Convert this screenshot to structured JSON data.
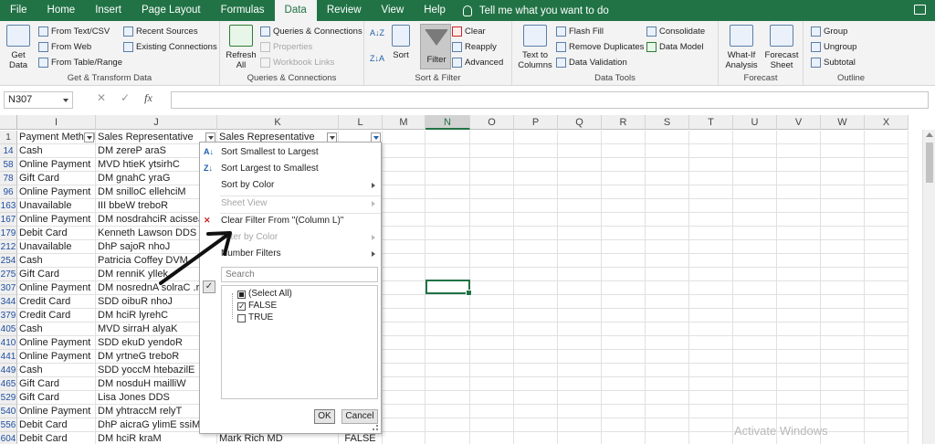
{
  "menu": {
    "tabs": [
      "File",
      "Home",
      "Insert",
      "Page Layout",
      "Formulas",
      "Data",
      "Review",
      "View",
      "Help"
    ],
    "active_tab": "Data",
    "tell_me": "Tell me what you want to do"
  },
  "ribbon": {
    "get_transform": {
      "get_data": "Get Data",
      "from_text_csv": "From Text/CSV",
      "from_web": "From Web",
      "from_table_range": "From Table/Range",
      "recent_sources": "Recent Sources",
      "existing_connections": "Existing Connections",
      "label": "Get & Transform Data"
    },
    "queries": {
      "refresh_all": "Refresh All",
      "queries_connections": "Queries & Connections",
      "properties": "Properties",
      "workbook_links": "Workbook Links",
      "label": "Queries & Connections"
    },
    "sort_filter": {
      "sort": "Sort",
      "filter": "Filter",
      "clear": "Clear",
      "reapply": "Reapply",
      "advanced": "Advanced",
      "label": "Sort & Filter"
    },
    "data_tools": {
      "text_to_columns": "Text to Columns",
      "flash_fill": "Flash Fill",
      "remove_duplicates": "Remove Duplicates",
      "data_validation": "Data Validation",
      "consolidate": "Consolidate",
      "data_model": "Data Model",
      "label": "Data Tools"
    },
    "forecast": {
      "what_if": "What-If Analysis",
      "forecast_sheet": "Forecast Sheet",
      "label": "Forecast"
    },
    "outline": {
      "group": "Group",
      "ungroup": "Ungroup",
      "subtotal": "Subtotal",
      "label": "Outline"
    }
  },
  "formula_bar": {
    "name_box": "N307",
    "fx": "fx",
    "cancel": "✕",
    "enter": "✓",
    "value": ""
  },
  "grid": {
    "column_headers": [
      "I",
      "J",
      "K",
      "L",
      "M",
      "N",
      "O",
      "P",
      "Q",
      "R",
      "S",
      "T",
      "U",
      "V",
      "W",
      "X"
    ],
    "selected_column": "N",
    "header_row": {
      "row_num": "1",
      "i": "Payment Method",
      "j": "Sales Representative",
      "k": "Sales Representative",
      "l": ""
    },
    "rows": [
      {
        "num": "14",
        "i": "Cash",
        "j": "DM zereP araS",
        "k": "",
        "l": ""
      },
      {
        "num": "58",
        "i": "Online Payment",
        "j": "MVD htieK ytsirhC",
        "k": "",
        "l": ""
      },
      {
        "num": "78",
        "i": "Gift Card",
        "j": "DM gnahC yraG",
        "k": "",
        "l": ""
      },
      {
        "num": "96",
        "i": "Online Payment",
        "j": "DM snilloC ellehciM",
        "k": "",
        "l": ""
      },
      {
        "num": "163",
        "i": "Unavailable",
        "j": "III bbeW treboR",
        "k": "",
        "l": ""
      },
      {
        "num": "167",
        "i": "Online Payment",
        "j": "DM nosdrahciR acisseJ",
        "k": "",
        "l": ""
      },
      {
        "num": "179",
        "i": "Debit Card",
        "j": "Kenneth Lawson DDS",
        "k": "",
        "l": ""
      },
      {
        "num": "212",
        "i": "Unavailable",
        "j": "DhP sajoR nhoJ",
        "k": "",
        "l": ""
      },
      {
        "num": "254",
        "i": "Cash",
        "j": "Patricia Coffey DVM",
        "k": "",
        "l": ""
      },
      {
        "num": "275",
        "i": "Gift Card",
        "j": "DM renniK yllek",
        "k": "",
        "l": ""
      },
      {
        "num": "307",
        "i": "Online Payment",
        "j": "DM nosrednA solraC .rM",
        "k": "",
        "l": ""
      },
      {
        "num": "344",
        "i": "Credit Card",
        "j": "SDD oibuR nhoJ",
        "k": "",
        "l": ""
      },
      {
        "num": "379",
        "i": "Credit Card",
        "j": "DM hciR lyrehC",
        "k": "",
        "l": ""
      },
      {
        "num": "405",
        "i": "Cash",
        "j": "MVD sirraH alyaK",
        "k": "",
        "l": ""
      },
      {
        "num": "410",
        "i": "Online Payment",
        "j": "SDD ekuD yendoR",
        "k": "",
        "l": ""
      },
      {
        "num": "441",
        "i": "Online Payment",
        "j": "DM yrtneG treboR",
        "k": "",
        "l": ""
      },
      {
        "num": "449",
        "i": "Cash",
        "j": "SDD yoccM htebazilE",
        "k": "",
        "l": ""
      },
      {
        "num": "465",
        "i": "Gift Card",
        "j": "DM nosduH mailliW",
        "k": "",
        "l": ""
      },
      {
        "num": "529",
        "i": "Gift Card",
        "j": "Lisa Jones DDS",
        "k": "",
        "l": ""
      },
      {
        "num": "540",
        "i": "Online Payment",
        "j": "DM yhtraccM relyT",
        "k": "",
        "l": ""
      },
      {
        "num": "556",
        "i": "Debit Card",
        "j": "DhP aicraG ylimE ssiM",
        "k": "",
        "l": ""
      },
      {
        "num": "604",
        "i": "Debit Card",
        "j": "DM hciR kraM",
        "k": "Mark Rich MD",
        "l": "FALSE"
      }
    ]
  },
  "filter_menu": {
    "sort_asc": "Sort Smallest to Largest",
    "sort_desc": "Sort Largest to Smallest",
    "sort_by_color": "Sort by Color",
    "sheet_view": "Sheet View",
    "clear_filter": "Clear Filter From \"(Column L)\"",
    "filter_by_color": "Filter by Color",
    "number_filters": "Number Filters",
    "search_placeholder": "Search",
    "items": [
      {
        "label": "(Select All)",
        "state": "partial"
      },
      {
        "label": "FALSE",
        "state": "checked"
      },
      {
        "label": "TRUE",
        "state": "unchecked"
      }
    ],
    "ok": "OK",
    "cancel": "Cancel"
  },
  "watermark": "Activate Windows",
  "colors": {
    "excel_green": "#217346",
    "ribbon_bg": "#f3f3f3",
    "row_link_blue": "#1f4fa0"
  }
}
